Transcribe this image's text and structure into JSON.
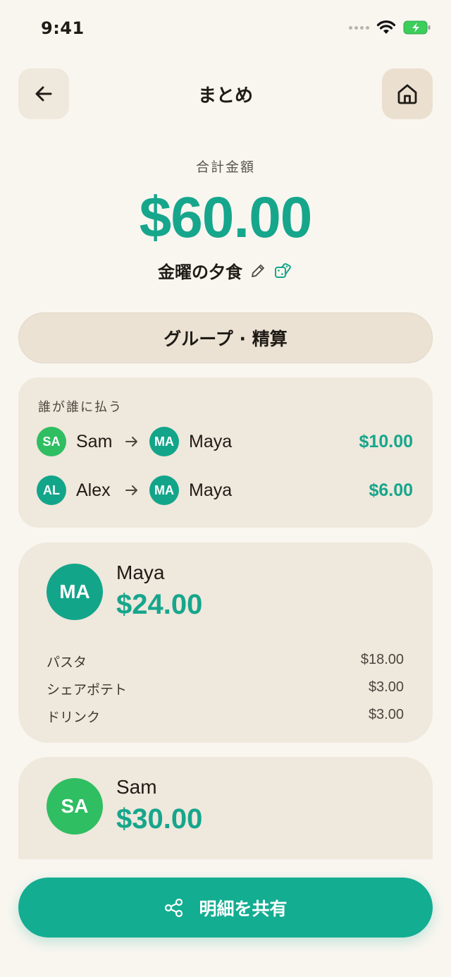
{
  "status_bar": {
    "time": "9:41"
  },
  "header": {
    "title": "まとめ"
  },
  "summary": {
    "total_label": "合計金額",
    "total_amount": "$60.00",
    "event_name": "金曜の夕食"
  },
  "mode_toggle": {
    "label": "グループ · 精算"
  },
  "settlements": {
    "title": "誰が誰に払う",
    "rows": [
      {
        "from_initials": "SA",
        "from_name": "Sam",
        "to_initials": "MA",
        "to_name": "Maya",
        "amount": "$10.00"
      },
      {
        "from_initials": "AL",
        "from_name": "Alex",
        "to_initials": "MA",
        "to_name": "Maya",
        "amount": "$6.00"
      }
    ]
  },
  "people": [
    {
      "initials": "MA",
      "name": "Maya",
      "amount": "$24.00",
      "items": [
        {
          "name": "パスタ",
          "price": "$18.00"
        },
        {
          "name": "シェアポテト",
          "price": "$3.00"
        },
        {
          "name": "ドリンク",
          "price": "$3.00"
        }
      ]
    },
    {
      "initials": "SA",
      "name": "Sam",
      "amount": "$30.00"
    }
  ],
  "share_button": {
    "label": "明細を共有"
  },
  "colors": {
    "accent": "#16a68c",
    "avatar_sam": "#2fbe62",
    "avatar_teal": "#13a58a",
    "background": "#f9f6f0",
    "card": "#efe8dc"
  }
}
